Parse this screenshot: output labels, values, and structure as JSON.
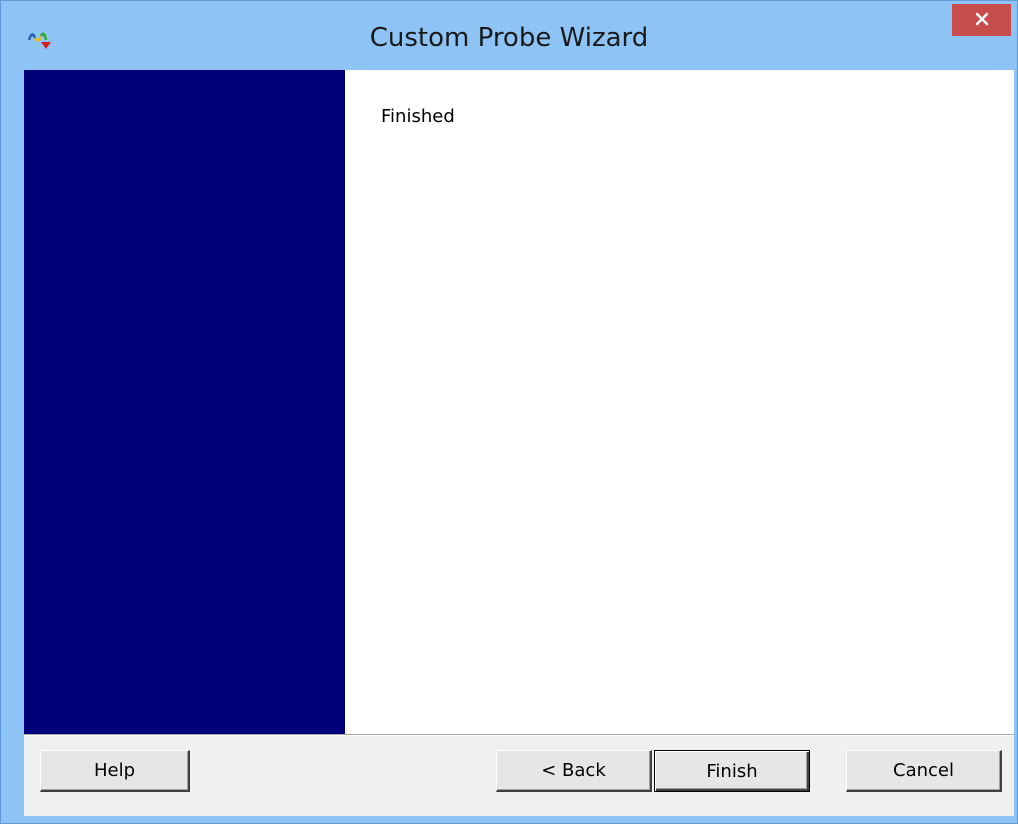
{
  "window": {
    "title": "Custom Probe Wizard",
    "close_label": "✕"
  },
  "icons": {
    "app": "probe-waveform-icon",
    "close": "close-icon"
  },
  "content": {
    "heading": "Finished"
  },
  "buttons": {
    "help": "Help",
    "back": "< Back",
    "finish": "Finish",
    "cancel": "Cancel"
  },
  "colors": {
    "titlebar": "#8ec3f5",
    "side_panel": "#00007b",
    "close_button": "#c74d4d",
    "content_bg": "#ffffff",
    "button_bar": "#f0f0f0"
  }
}
